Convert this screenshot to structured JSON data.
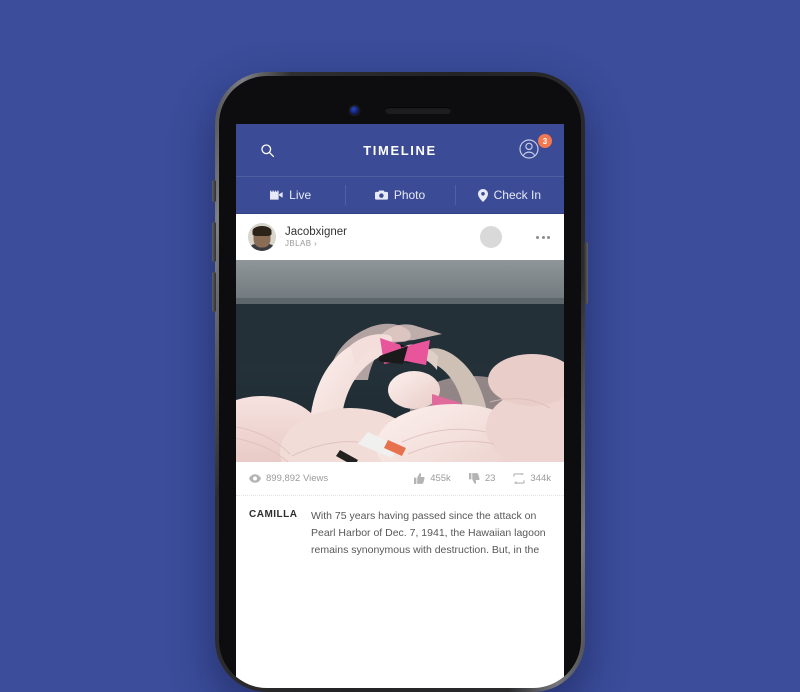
{
  "background": {
    "color": "#3b4d9b"
  },
  "device": {
    "name": "smartphone-mockup",
    "frame_color": "#232325",
    "buttons": [
      "silent-switch",
      "volume-up",
      "volume-down",
      "power"
    ]
  },
  "app": {
    "header": {
      "title": "TIMELINE",
      "search_icon": "search-icon",
      "profile_icon": "profile-icon",
      "badge_count": "3",
      "badge_color": "#f4784f",
      "background_color": "#3b4b96"
    },
    "action_tabs": [
      {
        "label": "Live",
        "icon": "video-camera-icon"
      },
      {
        "label": "Photo",
        "icon": "camera-icon"
      },
      {
        "label": "Check In",
        "icon": "map-pin-icon"
      }
    ],
    "post": {
      "author": "Jacobxigner",
      "subtitle": "JBLAB  ›",
      "avatar": "user-avatar",
      "overflow_menu": "•••",
      "photo_alt": "flamingos-photo",
      "stats": [
        {
          "name": "views",
          "icon": "eye-icon",
          "value": "899,892 Views"
        },
        {
          "name": "likes",
          "icon": "thumbs-up-icon",
          "value": "455k"
        },
        {
          "name": "dislikes",
          "icon": "thumbs-down-icon",
          "value": "23"
        },
        {
          "name": "shares",
          "icon": "share-icon",
          "value": "344k"
        }
      ],
      "caption_label": "CAMILLA",
      "caption_text": "With 75 years having passed since the attack on Pearl Harbor of Dec. 7, 1941, the Hawaiian lagoon remains synonymous with destruction. But, in the"
    }
  }
}
